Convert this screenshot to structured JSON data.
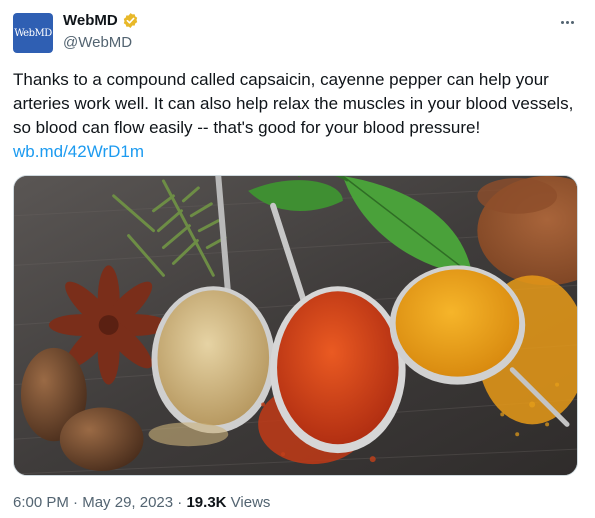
{
  "account": {
    "avatar_text": "WebMD",
    "display_name": "WebMD",
    "handle": "@WebMD",
    "verified_badge": "verified-gold-icon",
    "avatar_color": "#2f5fb3",
    "badge_color": "#e8b829"
  },
  "more_menu": {
    "icon": "more-horizontal-icon"
  },
  "tweet": {
    "text": "Thanks to a compound called capsaicin, cayenne pepper can help your arteries work well. It can also help relax the muscles in your blood vessels, so blood can flow easily -- that's good for your blood pressure!",
    "link": "wb.md/42WrD1m",
    "link_color": "#1d9bf0"
  },
  "meta": {
    "time": "6:00 PM",
    "separator": "·",
    "date": "May 29, 2023",
    "views_count": "19.3K",
    "views_label": "Views"
  }
}
